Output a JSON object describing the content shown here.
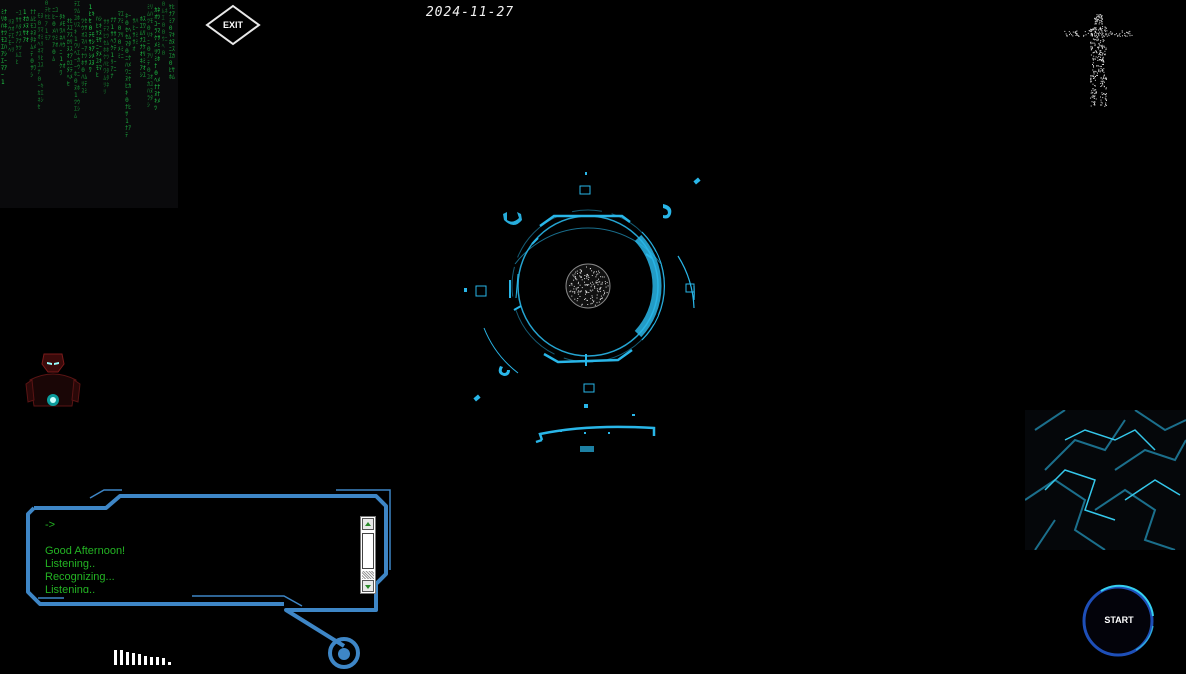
{
  "header": {
    "exit_label": "EXIT",
    "date": "2024-11-27"
  },
  "console": {
    "prompt": "->",
    "log": [
      "Good Afternoon!",
      "Listening..",
      "Recognizing...",
      "Listening.."
    ]
  },
  "controls": {
    "start_label": "START"
  },
  "voice_level": {
    "bars": [
      1,
      1,
      0.85,
      0.8,
      0.7,
      0.6,
      0.55,
      0.5,
      0.45,
      0.2
    ]
  },
  "colors": {
    "hud_cyan": "#29b6e8",
    "console_frame": "#3e86c6",
    "console_text": "#23b323",
    "matrix_green": "#1fd24a",
    "start_ring": "#1e4fb8"
  },
  "icons": {
    "matrix": "matrix-rain-panel",
    "exit": "exit-diamond-icon",
    "figure": "particle-humanoid-figure",
    "hud": "arc-reactor-hud",
    "robot": "ironman-helmet-icon",
    "circuit": "circuit-board-panel",
    "start": "start-ring-icon"
  }
}
